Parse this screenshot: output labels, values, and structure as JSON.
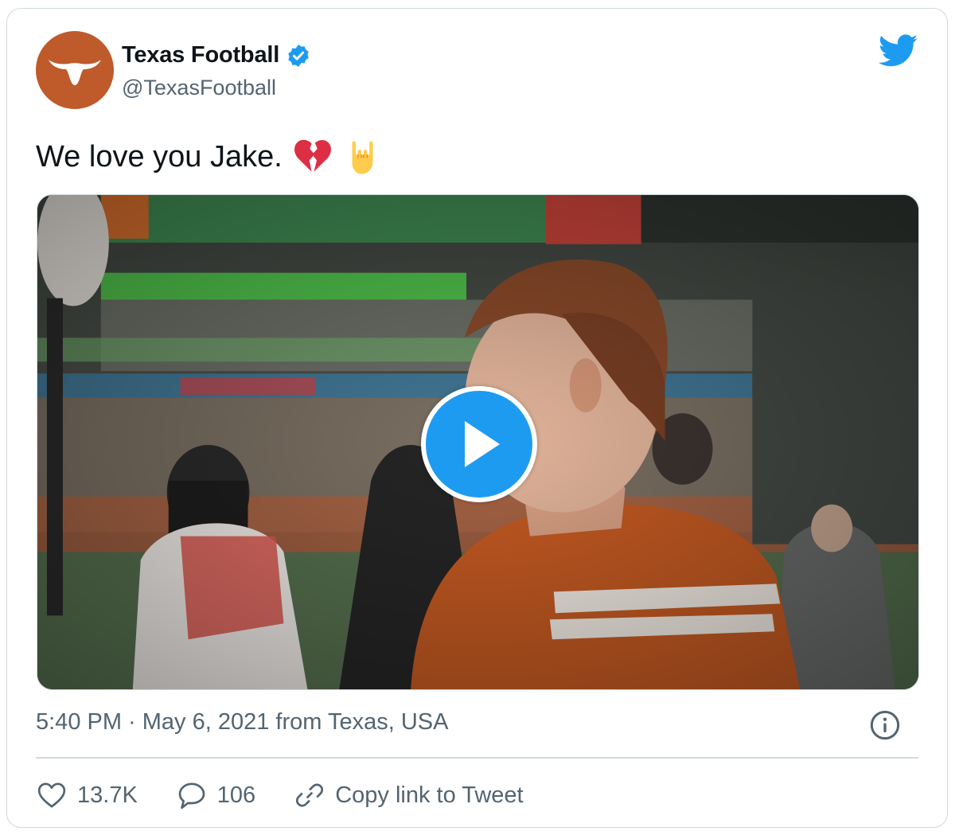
{
  "tweet": {
    "author_name": "Texas Football",
    "author_handle": "@TexasFootball",
    "verified": true,
    "text": "We love you Jake.",
    "emojis": [
      "broken-heart-icon",
      "rock-on-hand-icon"
    ],
    "timestamp": "5:40 PM · May 6, 2021 from Texas, USA"
  },
  "media": {
    "type": "video",
    "play_icon": "play-icon"
  },
  "actions": {
    "likes": "13.7K",
    "replies": "106",
    "copy_link_label": "Copy link to Tweet"
  },
  "colors": {
    "brand": "#1d9bf0",
    "avatar_bg": "#bf5a2a",
    "text": "#0f1419",
    "muted": "#536471",
    "border": "#cfd9de"
  }
}
